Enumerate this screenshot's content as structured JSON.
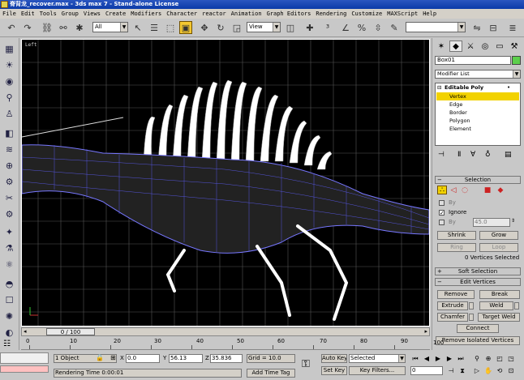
{
  "window": {
    "title": "脊背龙_recover.max - 3ds max 7  - Stand-alone License",
    "accent": "#0b3aa8"
  },
  "menu": [
    "File",
    "Edit",
    "Tools",
    "Group",
    "Views",
    "Create",
    "Modifiers",
    "Character",
    "reactor",
    "Animation",
    "Graph Editors",
    "Rendering",
    "Customize",
    "MAXScript",
    "Help"
  ],
  "toolbar": {
    "selection_filter": "All",
    "ref_coord": "View",
    "named_sel_placeholder": ""
  },
  "viewport": {
    "label": "Left",
    "bg": "#000000",
    "wire_color": "#4a4aff"
  },
  "command_panel": {
    "object_name": "Box01",
    "object_color": "#5ccf4c",
    "modifier_list": "Modifier List",
    "stack": {
      "root": "Editable Poly",
      "items": [
        "Vertex",
        "Edge",
        "Border",
        "Polygon",
        "Element"
      ],
      "selected": "Vertex"
    },
    "selection": {
      "title": "Selection",
      "by_label": "By",
      "ignore_label": "Ignore",
      "by2_label": "By",
      "angle_value": "45.0",
      "shrink": "Shrink",
      "grow": "Grow",
      "ring": "Ring",
      "loop": "Loop",
      "status": "0 Vertices Selected"
    },
    "soft_selection": {
      "title": "Soft Selection"
    },
    "edit_vertices": {
      "title": "Edit Vertices",
      "remove": "Remove",
      "break": "Break",
      "extrude": "Extrude",
      "weld": "Weld",
      "chamfer": "Chamfer",
      "target_weld": "Target Weld",
      "connect": "Connect",
      "remove_isolated": "Remove Isolated Vertices"
    }
  },
  "timeline": {
    "frame_display": "0 / 100",
    "ticks": [
      "0",
      "10",
      "20",
      "30",
      "40",
      "50",
      "60",
      "70",
      "80",
      "90",
      "100"
    ]
  },
  "status": {
    "selection": "1 Object",
    "x_label": "X",
    "x_value": "0.0",
    "y_label": "Y",
    "y_value": "56.13",
    "z_label": "Z",
    "z_value": "35.836",
    "grid": "Grid = 10.0",
    "prompt": "Rendering Time  0:00:01",
    "add_time_tag": "Add Time Tag",
    "auto_key": "Auto Key",
    "set_key": "Set Key",
    "selected_option": "Selected",
    "key_filters": "Key Filters...",
    "frame": "0"
  }
}
